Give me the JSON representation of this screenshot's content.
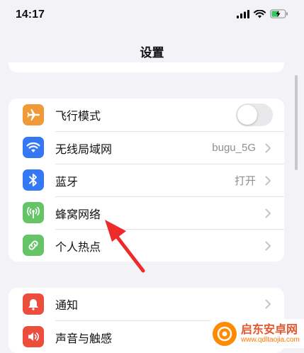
{
  "status_bar": {
    "time": "14:17"
  },
  "nav": {
    "title": "设置"
  },
  "section1": {
    "items": [
      {
        "label": "飞行模式",
        "icon": "airplane-icon",
        "color": "#f09a37",
        "toggle": false
      },
      {
        "label": "无线局域网",
        "icon": "wifi-icon",
        "color": "#3478f6",
        "value": "bugu_5G"
      },
      {
        "label": "蓝牙",
        "icon": "bluetooth-icon",
        "color": "#3478f6",
        "value": "打开"
      },
      {
        "label": "蜂窝网络",
        "icon": "antenna-icon",
        "color": "#65c466"
      },
      {
        "label": "个人热点",
        "icon": "hotspot-icon",
        "color": "#65c466"
      }
    ]
  },
  "section2": {
    "items": [
      {
        "label": "通知",
        "icon": "notification-icon",
        "color": "#eb4e3d"
      },
      {
        "label": "声音与触感",
        "icon": "speaker-icon",
        "color": "#eb4e3d"
      }
    ]
  },
  "watermark": {
    "title": "启东安卓网",
    "url": "www.qdltaojia.com"
  }
}
